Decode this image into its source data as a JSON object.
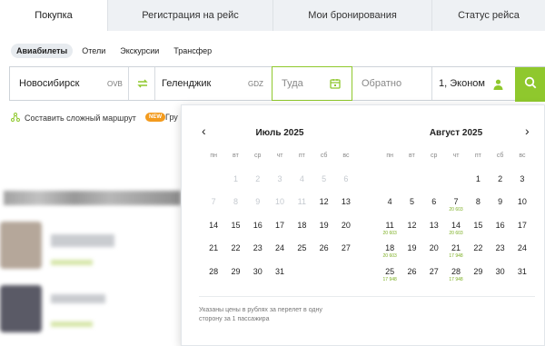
{
  "tabs": [
    {
      "label": "Покупка",
      "active": true
    },
    {
      "label": "Регистрация на рейс",
      "active": false
    },
    {
      "label": "Мои бронирования",
      "active": false
    },
    {
      "label": "Статус рейса",
      "active": false
    }
  ],
  "subnav": [
    "Авиабилеты",
    "Отели",
    "Экскурсии",
    "Трансфер"
  ],
  "search": {
    "from": "Новосибирск",
    "from_code": "OVB",
    "to": "Геленджик",
    "to_code": "GDZ",
    "depart_placeholder": "Туда",
    "return_placeholder": "Обратно",
    "passengers": "1, Эконом"
  },
  "route_link": "Составить сложный маршрут",
  "new_badge": "NEW",
  "group_text": "Гру",
  "calendar": {
    "weekdays": [
      "пн",
      "вт",
      "ср",
      "чт",
      "пт",
      "сб",
      "вс"
    ],
    "months": [
      {
        "title": "Июль 2025",
        "cells": [
          {
            "d": "",
            "p": ""
          },
          {
            "d": "1",
            "p": "",
            "m": true
          },
          {
            "d": "2",
            "p": "",
            "m": true
          },
          {
            "d": "3",
            "p": "",
            "m": true
          },
          {
            "d": "4",
            "p": "",
            "m": true
          },
          {
            "d": "5",
            "p": "",
            "m": true
          },
          {
            "d": "6",
            "p": "",
            "m": true
          },
          {
            "d": "7",
            "p": "",
            "m": true
          },
          {
            "d": "8",
            "p": "",
            "m": true
          },
          {
            "d": "9",
            "p": "",
            "m": true
          },
          {
            "d": "10",
            "p": "",
            "m": true
          },
          {
            "d": "11",
            "p": "",
            "m": true
          },
          {
            "d": "12",
            "p": ""
          },
          {
            "d": "13",
            "p": ""
          },
          {
            "d": "14",
            "p": ""
          },
          {
            "d": "15",
            "p": ""
          },
          {
            "d": "16",
            "p": ""
          },
          {
            "d": "17",
            "p": ""
          },
          {
            "d": "18",
            "p": ""
          },
          {
            "d": "19",
            "p": ""
          },
          {
            "d": "20",
            "p": ""
          },
          {
            "d": "21",
            "p": ""
          },
          {
            "d": "22",
            "p": ""
          },
          {
            "d": "23",
            "p": ""
          },
          {
            "d": "24",
            "p": ""
          },
          {
            "d": "25",
            "p": ""
          },
          {
            "d": "26",
            "p": ""
          },
          {
            "d": "27",
            "p": ""
          },
          {
            "d": "28",
            "p": ""
          },
          {
            "d": "29",
            "p": ""
          },
          {
            "d": "30",
            "p": ""
          },
          {
            "d": "31",
            "p": ""
          }
        ]
      },
      {
        "title": "Август 2025",
        "cells": [
          {
            "d": "",
            "p": ""
          },
          {
            "d": "",
            "p": ""
          },
          {
            "d": "",
            "p": ""
          },
          {
            "d": "",
            "p": ""
          },
          {
            "d": "1",
            "p": ""
          },
          {
            "d": "2",
            "p": ""
          },
          {
            "d": "3",
            "p": ""
          },
          {
            "d": "4",
            "p": ""
          },
          {
            "d": "5",
            "p": ""
          },
          {
            "d": "6",
            "p": ""
          },
          {
            "d": "7",
            "p": "20 603"
          },
          {
            "d": "8",
            "p": ""
          },
          {
            "d": "9",
            "p": ""
          },
          {
            "d": "10",
            "p": ""
          },
          {
            "d": "11",
            "p": "20 603"
          },
          {
            "d": "12",
            "p": ""
          },
          {
            "d": "13",
            "p": ""
          },
          {
            "d": "14",
            "p": "20 603"
          },
          {
            "d": "15",
            "p": ""
          },
          {
            "d": "16",
            "p": ""
          },
          {
            "d": "17",
            "p": ""
          },
          {
            "d": "18",
            "p": "20 603"
          },
          {
            "d": "19",
            "p": ""
          },
          {
            "d": "20",
            "p": ""
          },
          {
            "d": "21",
            "p": "17 948"
          },
          {
            "d": "22",
            "p": ""
          },
          {
            "d": "23",
            "p": ""
          },
          {
            "d": "24",
            "p": ""
          },
          {
            "d": "25",
            "p": "17 948"
          },
          {
            "d": "26",
            "p": ""
          },
          {
            "d": "27",
            "p": ""
          },
          {
            "d": "28",
            "p": "17 948"
          },
          {
            "d": "29",
            "p": ""
          },
          {
            "d": "30",
            "p": ""
          },
          {
            "d": "31",
            "p": ""
          }
        ]
      }
    ],
    "note": "Указаны цены в рублях за перелет в одну сторону за 1 пассажира"
  },
  "colors": {
    "accent": "#8fc82d",
    "price": "#7aae1f",
    "new_badge": "#f39b1e"
  }
}
